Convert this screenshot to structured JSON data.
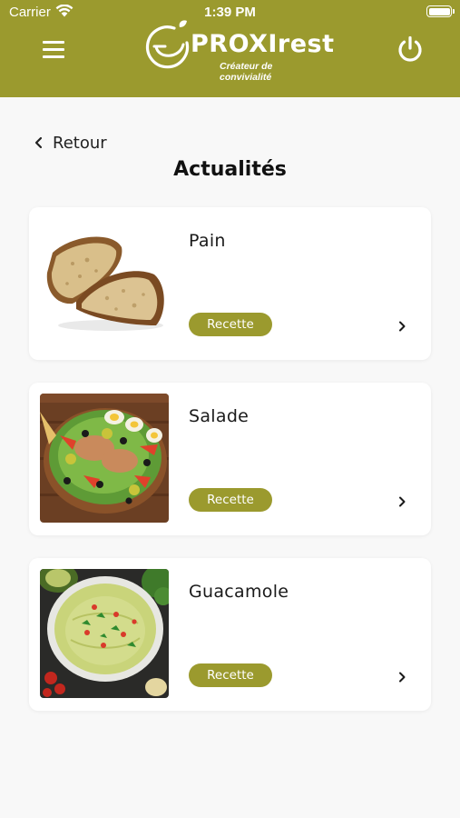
{
  "status_bar": {
    "carrier": "Carrier",
    "time": "1:39 PM"
  },
  "header": {
    "brand_name": "PROXIrest",
    "brand_tagline": "Créateur de convivialité",
    "menu_icon": "hamburger-menu-icon",
    "power_icon": "power-icon",
    "background_color": "#9b9a2e"
  },
  "navigation": {
    "back_label": "Retour",
    "back_icon": "chevron-left-icon"
  },
  "page": {
    "title": "Actualités"
  },
  "articles": [
    {
      "title": "Pain",
      "badge": "Recette",
      "image": "bread-photo",
      "chevron_icon": "chevron-right-icon"
    },
    {
      "title": "Salade",
      "badge": "Recette",
      "image": "salad-photo",
      "chevron_icon": "chevron-right-icon"
    },
    {
      "title": "Guacamole",
      "badge": "Recette",
      "image": "guacamole-photo",
      "chevron_icon": "chevron-right-icon"
    }
  ],
  "colors": {
    "accent": "#9b9a2e",
    "background": "#f8f8f8",
    "card": "#ffffff"
  }
}
